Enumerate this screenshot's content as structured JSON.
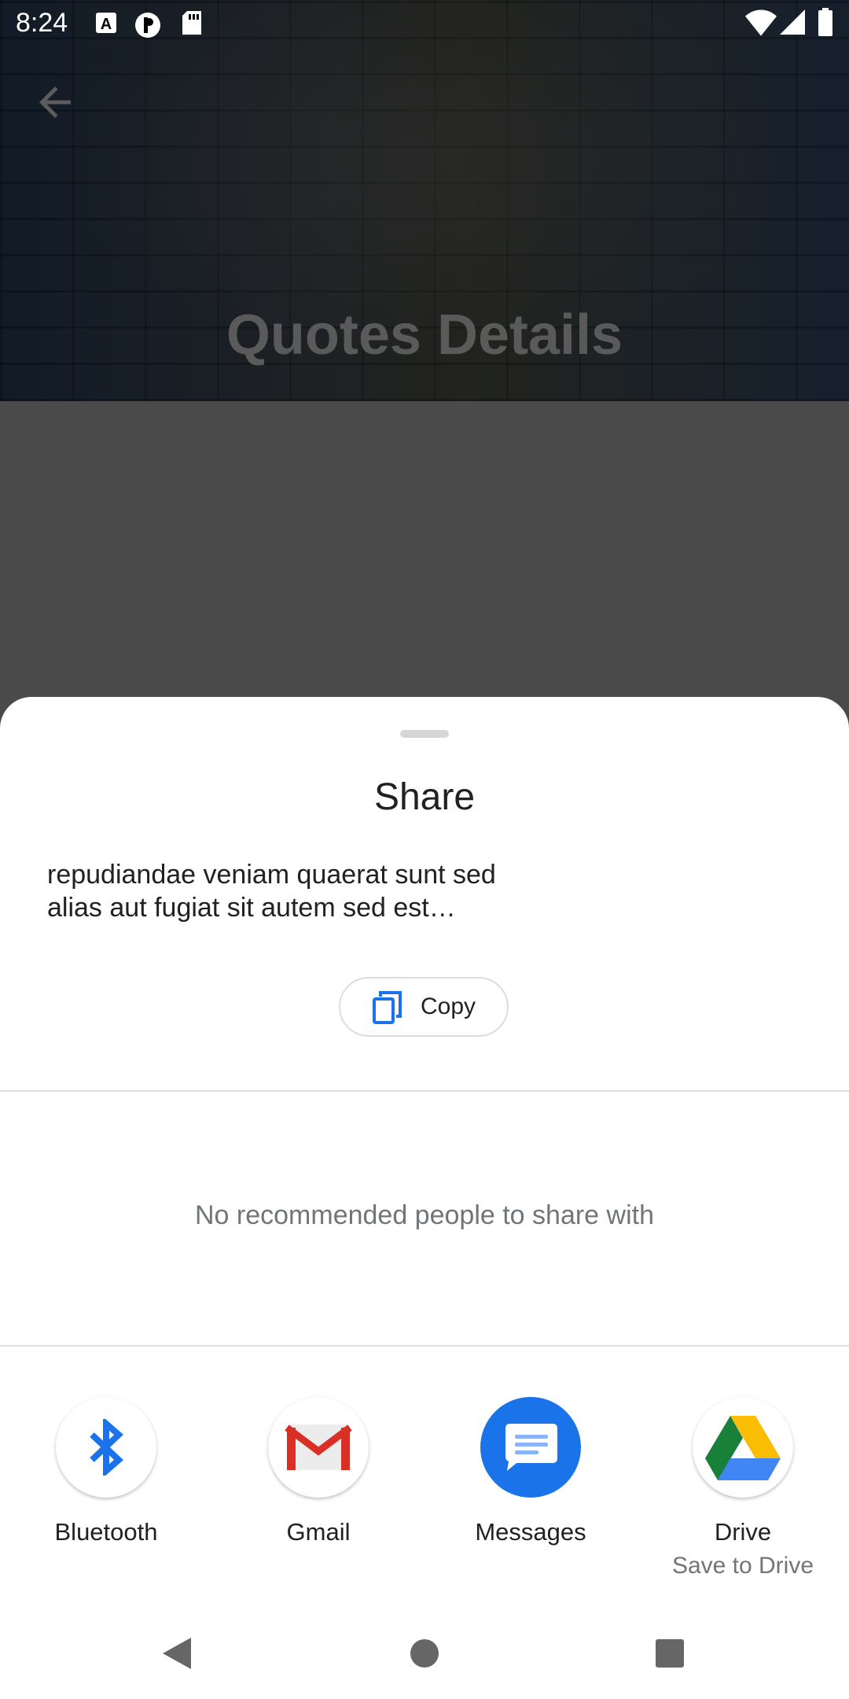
{
  "status_bar": {
    "time": "8:24"
  },
  "header": {
    "title": "Quotes Details"
  },
  "share_sheet": {
    "title": "Share",
    "preview_line1": "repudiandae veniam quaerat sunt sed",
    "preview_line2": "alias aut fugiat sit autem sed est…",
    "copy_label": "Copy",
    "no_recommended_text": "No recommended people to share with",
    "targets": [
      {
        "label": "Bluetooth",
        "icon": "bluetooth-icon"
      },
      {
        "label": "Gmail",
        "icon": "gmail-icon"
      },
      {
        "label": "Messages",
        "icon": "messages-icon"
      },
      {
        "label": "Drive",
        "sublabel": "Save to Drive",
        "icon": "drive-icon"
      }
    ]
  },
  "colors": {
    "accent_blue": "#1a73e8",
    "gmail_red": "#d93025",
    "drive_green": "#188038",
    "drive_yellow": "#fbbc04"
  }
}
